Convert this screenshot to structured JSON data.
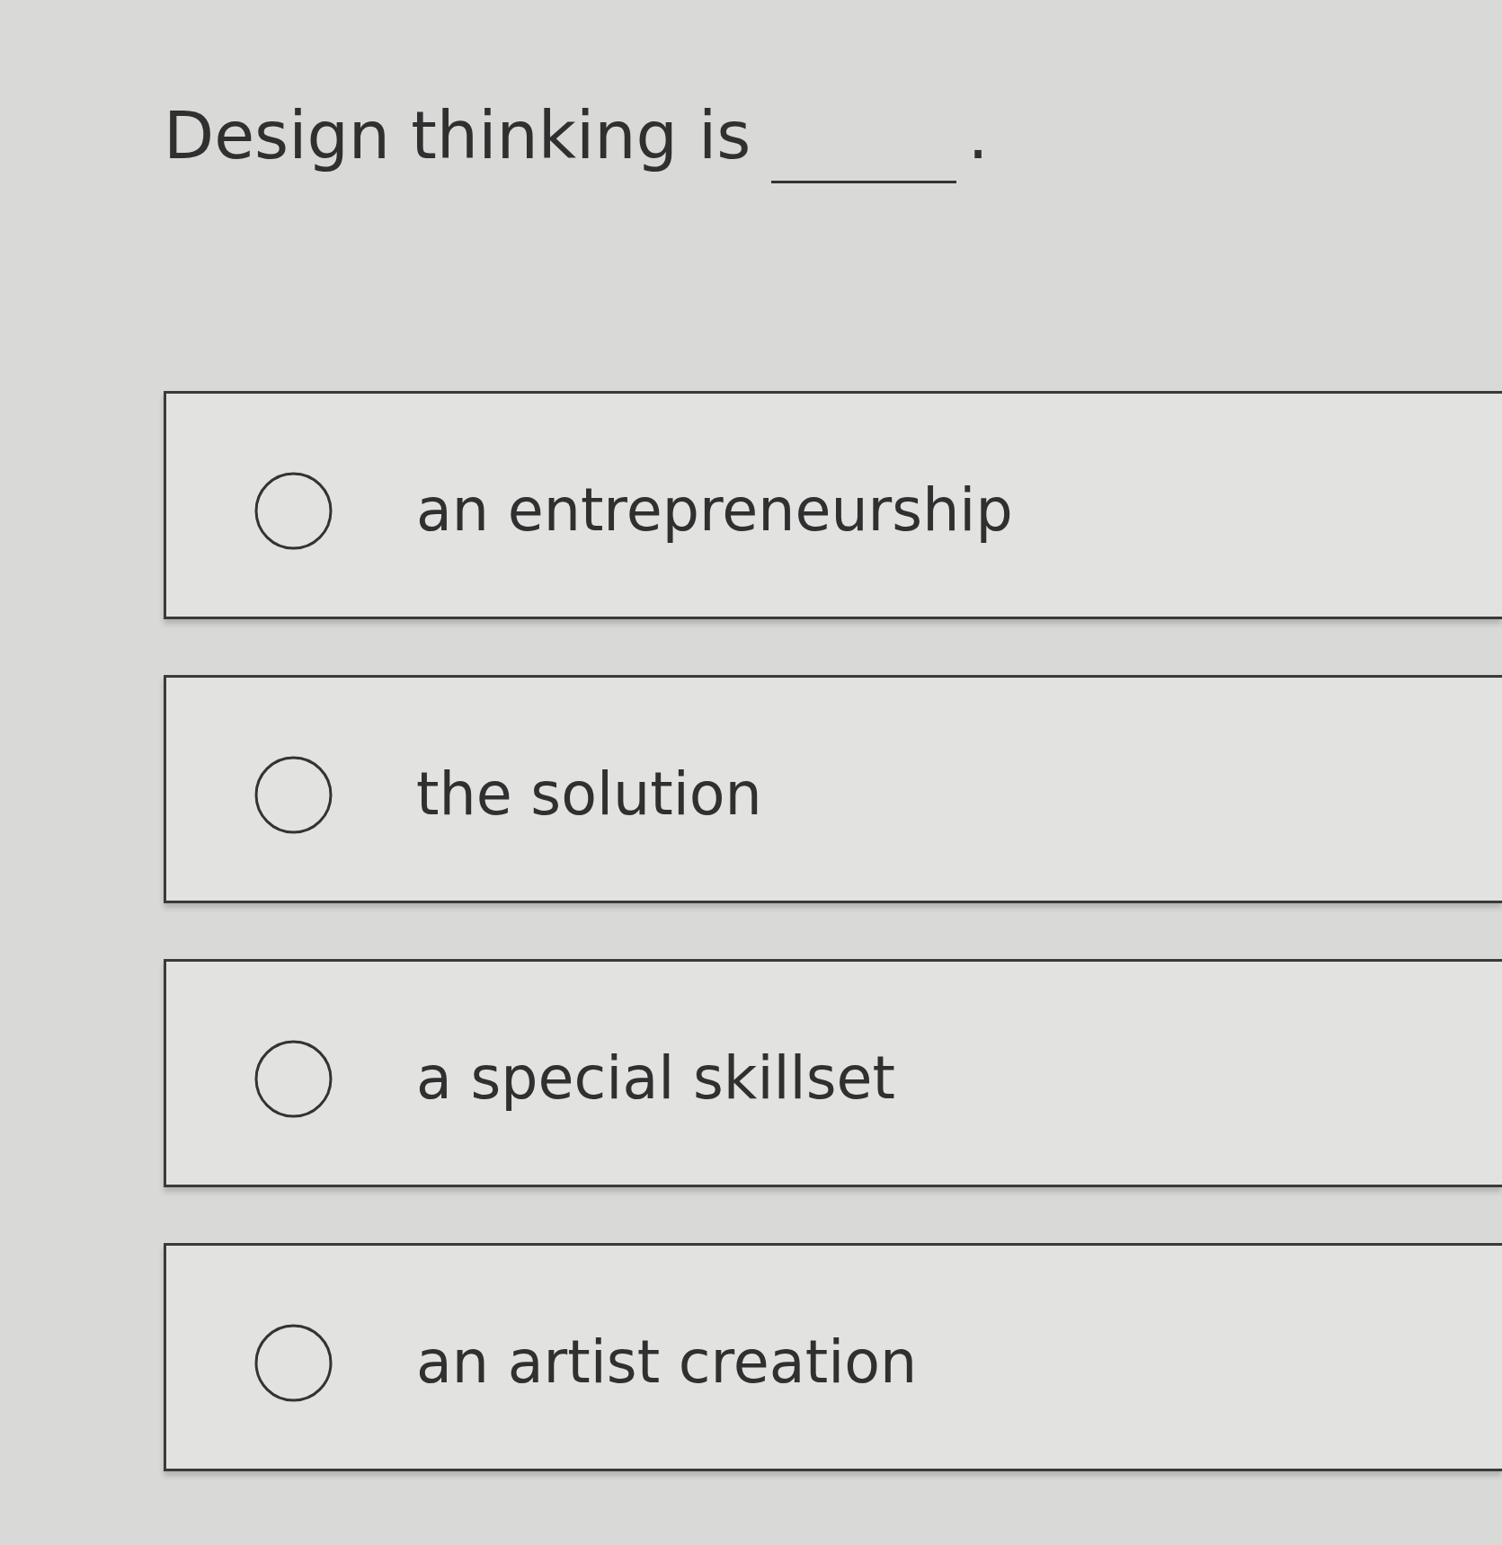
{
  "question": {
    "text": "Design thinking is",
    "blank": true,
    "end": "."
  },
  "options": [
    {
      "label": "an entrepreneurship",
      "selected": false
    },
    {
      "label": "the solution",
      "selected": false
    },
    {
      "label": "a special skillset",
      "selected": false
    },
    {
      "label": "an artist creation",
      "selected": false
    }
  ]
}
